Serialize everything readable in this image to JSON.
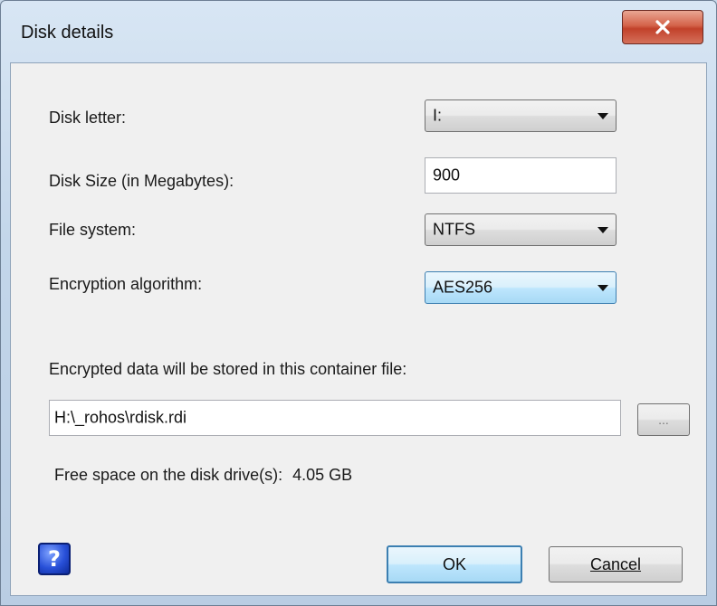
{
  "window": {
    "title": "Disk details",
    "close_icon": "close-x-icon"
  },
  "form": {
    "disk_letter": {
      "label": "Disk letter:",
      "value": "I:"
    },
    "disk_size": {
      "label": "Disk Size (in Megabytes):",
      "value": "900"
    },
    "file_system": {
      "label": "File system:",
      "value": "NTFS"
    },
    "encryption": {
      "label": "Encryption algorithm:",
      "value": "AES256"
    },
    "container": {
      "label": "Encrypted data will be stored in this container file:",
      "path": "H:\\_rohos\\rdisk.rdi",
      "browse_label": "..."
    },
    "free_space": {
      "label": "Free space on the disk drive(s):",
      "value": "4.05 GB"
    }
  },
  "footer": {
    "help_glyph": "?",
    "help_icon": "help-question-icon",
    "ok_label": "OK",
    "cancel_label": "Cancel"
  }
}
